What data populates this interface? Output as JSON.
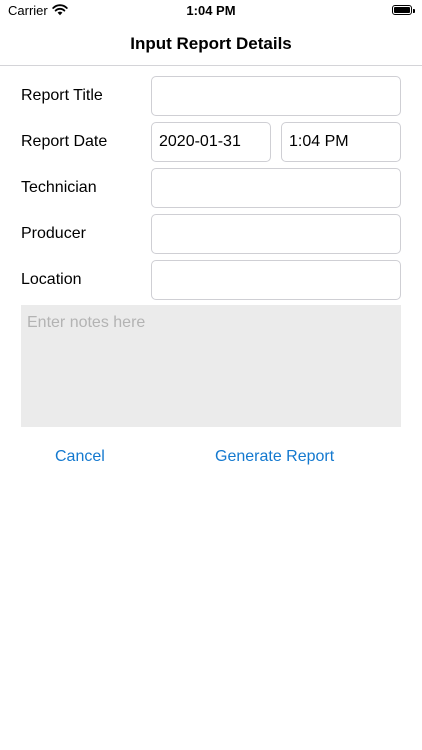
{
  "status_bar": {
    "carrier": "Carrier",
    "time": "1:04 PM",
    "wifi_icon": "wifi-icon",
    "battery_icon": "battery-icon"
  },
  "nav": {
    "title": "Input Report Details"
  },
  "form": {
    "report_title": {
      "label": "Report Title",
      "value": ""
    },
    "report_date": {
      "label": "Report Date",
      "date_value": "2020-01-31",
      "time_value": "1:04 PM"
    },
    "technician": {
      "label": "Technician",
      "value": ""
    },
    "producer": {
      "label": "Producer",
      "value": ""
    },
    "location": {
      "label": "Location",
      "value": ""
    },
    "notes": {
      "placeholder": "Enter notes here",
      "value": ""
    }
  },
  "actions": {
    "cancel_label": "Cancel",
    "generate_label": "Generate Report"
  },
  "colors": {
    "accent": "#1479cf",
    "notes_background": "#ebebeb",
    "placeholder": "#b3b3b3",
    "field_border": "#cfcfd4"
  }
}
